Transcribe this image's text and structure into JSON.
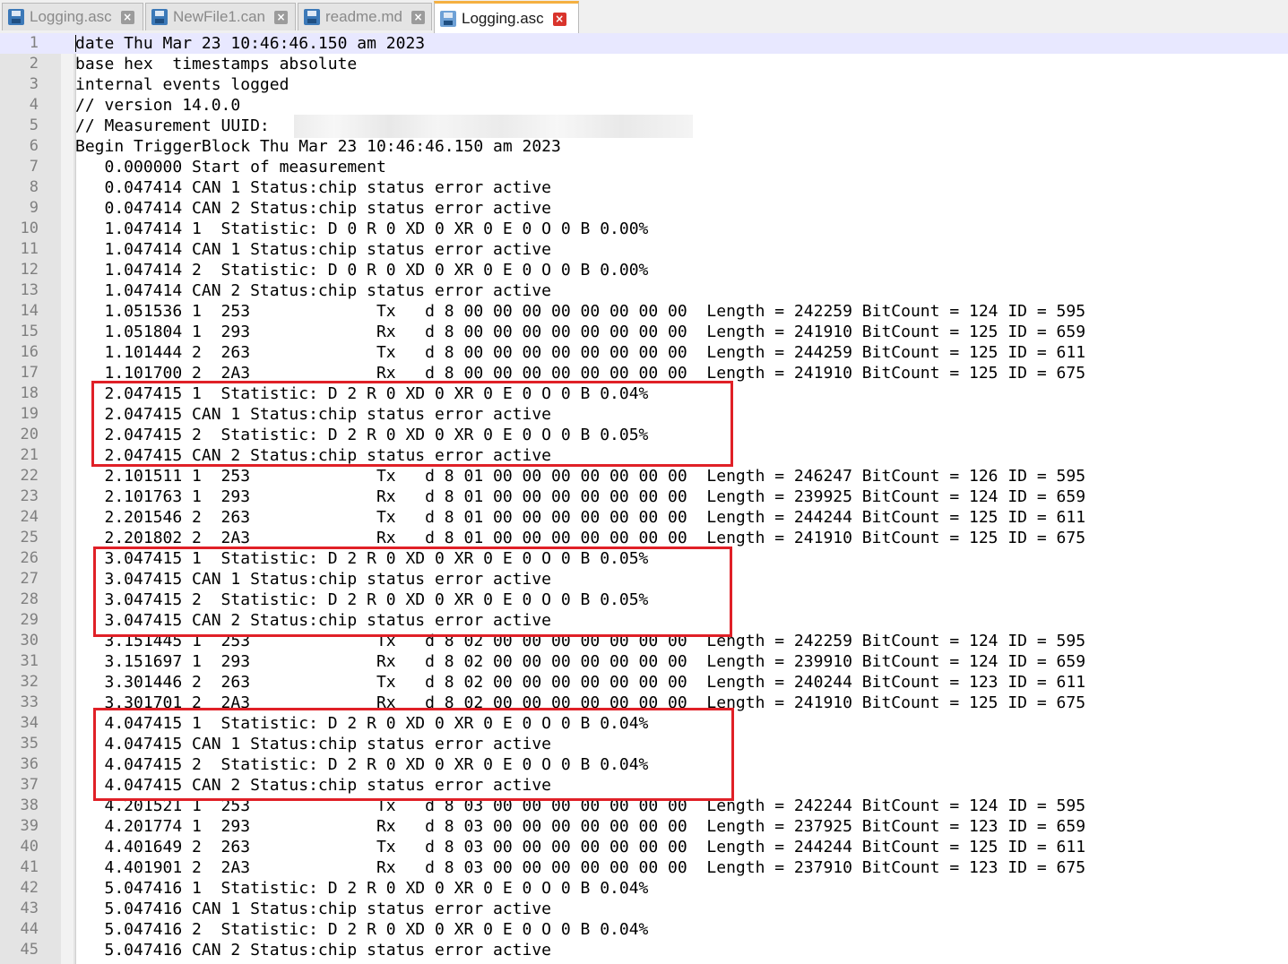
{
  "tabs": [
    {
      "label": "Logging.asc",
      "active": false
    },
    {
      "label": "NewFile1.can",
      "active": false
    },
    {
      "label": "readme.md",
      "active": false
    },
    {
      "label": "Logging.asc",
      "active": true
    }
  ],
  "close_glyph": "×",
  "icons": {
    "tab": "save-disk-icon",
    "close": "close-icon"
  },
  "colors": {
    "highlight_box": "#e02027",
    "active_tab_accent": "#f5b041",
    "current_line": "#e8e8ff"
  },
  "editor": {
    "lines": [
      {
        "n": "1",
        "text": "date Thu Mar 23 10:46:46.150 am 2023"
      },
      {
        "n": "2",
        "text": "base hex  timestamps absolute"
      },
      {
        "n": "3",
        "text": "internal events logged"
      },
      {
        "n": "4",
        "text": "// version 14.0.0"
      },
      {
        "n": "5",
        "text": "// Measurement UUID:"
      },
      {
        "n": "6",
        "text": "Begin TriggerBlock Thu Mar 23 10:46:46.150 am 2023"
      },
      {
        "n": "7",
        "text": "   0.000000 Start of measurement"
      },
      {
        "n": "8",
        "text": "   0.047414 CAN 1 Status:chip status error active"
      },
      {
        "n": "9",
        "text": "   0.047414 CAN 2 Status:chip status error active"
      },
      {
        "n": "10",
        "text": "   1.047414 1  Statistic: D 0 R 0 XD 0 XR 0 E 0 O 0 B 0.00%"
      },
      {
        "n": "11",
        "text": "   1.047414 CAN 1 Status:chip status error active"
      },
      {
        "n": "12",
        "text": "   1.047414 2  Statistic: D 0 R 0 XD 0 XR 0 E 0 O 0 B 0.00%"
      },
      {
        "n": "13",
        "text": "   1.047414 CAN 2 Status:chip status error active"
      },
      {
        "n": "14",
        "text": "   1.051536 1  253             Tx   d 8 00 00 00 00 00 00 00 00  Length = 242259 BitCount = 124 ID = 595"
      },
      {
        "n": "15",
        "text": "   1.051804 1  293             Rx   d 8 00 00 00 00 00 00 00 00  Length = 241910 BitCount = 125 ID = 659"
      },
      {
        "n": "16",
        "text": "   1.101444 2  263             Tx   d 8 00 00 00 00 00 00 00 00  Length = 244259 BitCount = 125 ID = 611"
      },
      {
        "n": "17",
        "text": "   1.101700 2  2A3             Rx   d 8 00 00 00 00 00 00 00 00  Length = 241910 BitCount = 125 ID = 675"
      },
      {
        "n": "18",
        "text": "   2.047415 1  Statistic: D 2 R 0 XD 0 XR 0 E 0 O 0 B 0.04%"
      },
      {
        "n": "19",
        "text": "   2.047415 CAN 1 Status:chip status error active"
      },
      {
        "n": "20",
        "text": "   2.047415 2  Statistic: D 2 R 0 XD 0 XR 0 E 0 O 0 B 0.05%"
      },
      {
        "n": "21",
        "text": "   2.047415 CAN 2 Status:chip status error active"
      },
      {
        "n": "22",
        "text": "   2.101511 1  253             Tx   d 8 01 00 00 00 00 00 00 00  Length = 246247 BitCount = 126 ID = 595"
      },
      {
        "n": "23",
        "text": "   2.101763 1  293             Rx   d 8 01 00 00 00 00 00 00 00  Length = 239925 BitCount = 124 ID = 659"
      },
      {
        "n": "24",
        "text": "   2.201546 2  263             Tx   d 8 01 00 00 00 00 00 00 00  Length = 244244 BitCount = 125 ID = 611"
      },
      {
        "n": "25",
        "text": "   2.201802 2  2A3             Rx   d 8 01 00 00 00 00 00 00 00  Length = 241910 BitCount = 125 ID = 675"
      },
      {
        "n": "26",
        "text": "   3.047415 1  Statistic: D 2 R 0 XD 0 XR 0 E 0 O 0 B 0.05%"
      },
      {
        "n": "27",
        "text": "   3.047415 CAN 1 Status:chip status error active"
      },
      {
        "n": "28",
        "text": "   3.047415 2  Statistic: D 2 R 0 XD 0 XR 0 E 0 O 0 B 0.05%"
      },
      {
        "n": "29",
        "text": "   3.047415 CAN 2 Status:chip status error active"
      },
      {
        "n": "30",
        "text": "   3.151445 1  253             Tx   d 8 02 00 00 00 00 00 00 00  Length = 242259 BitCount = 124 ID = 595"
      },
      {
        "n": "31",
        "text": "   3.151697 1  293             Rx   d 8 02 00 00 00 00 00 00 00  Length = 239910 BitCount = 124 ID = 659"
      },
      {
        "n": "32",
        "text": "   3.301446 2  263             Tx   d 8 02 00 00 00 00 00 00 00  Length = 240244 BitCount = 123 ID = 611"
      },
      {
        "n": "33",
        "text": "   3.301701 2  2A3             Rx   d 8 02 00 00 00 00 00 00 00  Length = 241910 BitCount = 125 ID = 675"
      },
      {
        "n": "34",
        "text": "   4.047415 1  Statistic: D 2 R 0 XD 0 XR 0 E 0 O 0 B 0.04%"
      },
      {
        "n": "35",
        "text": "   4.047415 CAN 1 Status:chip status error active"
      },
      {
        "n": "36",
        "text": "   4.047415 2  Statistic: D 2 R 0 XD 0 XR 0 E 0 O 0 B 0.04%"
      },
      {
        "n": "37",
        "text": "   4.047415 CAN 2 Status:chip status error active"
      },
      {
        "n": "38",
        "text": "   4.201521 1  253             Tx   d 8 03 00 00 00 00 00 00 00  Length = 242244 BitCount = 124 ID = 595"
      },
      {
        "n": "39",
        "text": "   4.201774 1  293             Rx   d 8 03 00 00 00 00 00 00 00  Length = 237925 BitCount = 123 ID = 659"
      },
      {
        "n": "40",
        "text": "   4.401649 2  263             Tx   d 8 03 00 00 00 00 00 00 00  Length = 244244 BitCount = 125 ID = 611"
      },
      {
        "n": "41",
        "text": "   4.401901 2  2A3             Rx   d 8 03 00 00 00 00 00 00 00  Length = 237910 BitCount = 123 ID = 675"
      },
      {
        "n": "42",
        "text": "   5.047416 1  Statistic: D 2 R 0 XD 0 XR 0 E 0 O 0 B 0.04%"
      },
      {
        "n": "43",
        "text": "   5.047416 CAN 1 Status:chip status error active"
      },
      {
        "n": "44",
        "text": "   5.047416 2  Statistic: D 2 R 0 XD 0 XR 0 E 0 O 0 B 0.04%"
      },
      {
        "n": "45",
        "text": "   5.047416 CAN 2 Status:chip status error active"
      }
    ]
  }
}
